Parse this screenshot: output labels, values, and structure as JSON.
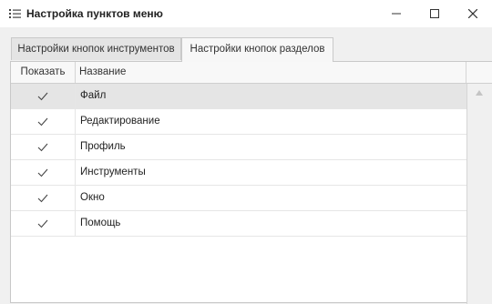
{
  "window": {
    "title": "Настройка пунктов меню",
    "icon": "list-settings-icon"
  },
  "tabs": [
    {
      "label": "Настройки кнопок инструментов",
      "active": false
    },
    {
      "label": "Настройки кнопок разделов",
      "active": true
    }
  ],
  "table": {
    "columns": [
      "Показать",
      "Название"
    ],
    "rows": [
      {
        "checked": true,
        "name": "Файл",
        "selected": true
      },
      {
        "checked": true,
        "name": "Редактирование",
        "selected": false
      },
      {
        "checked": true,
        "name": "Профиль",
        "selected": false
      },
      {
        "checked": true,
        "name": "Инструменты",
        "selected": false
      },
      {
        "checked": true,
        "name": "Окно",
        "selected": false
      },
      {
        "checked": true,
        "name": "Помощь",
        "selected": false
      }
    ]
  },
  "colors": {
    "selected_row": "#e5e5e5",
    "background": "#f0f0f0",
    "check": "#444444"
  }
}
